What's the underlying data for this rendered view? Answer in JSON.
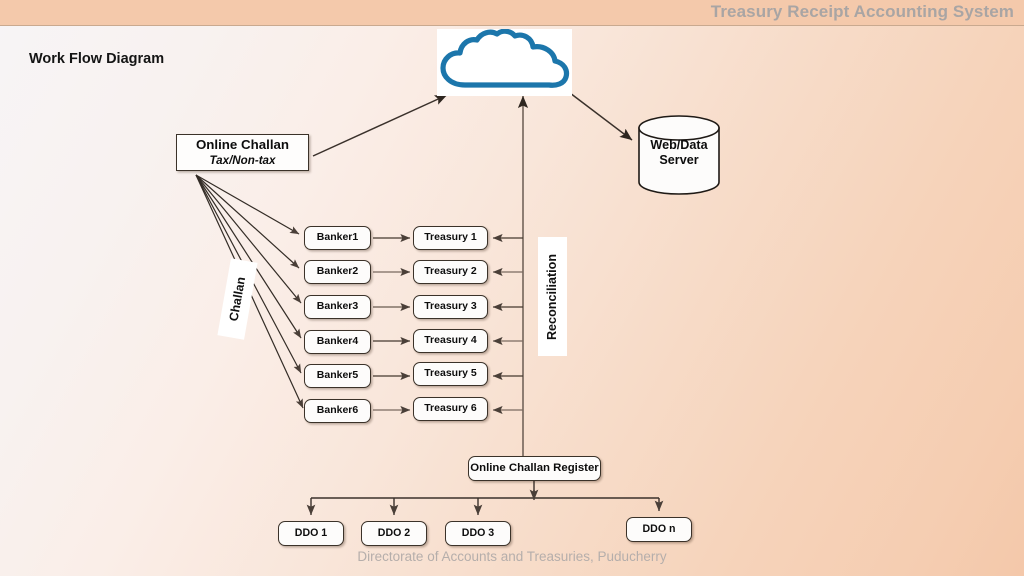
{
  "header": {
    "title": "Treasury Receipt Accounting System"
  },
  "page": {
    "title": "Work Flow Diagram",
    "footer": "Directorate of Accounts and Treasuries, Puducherry"
  },
  "diagram": {
    "cloud": {
      "icon": "cloud-icon",
      "label": ""
    },
    "online_challan": {
      "title": "Online Challan",
      "subtitle": "Tax/Non-tax"
    },
    "server": {
      "label_line1": "Web/Data",
      "label_line2": "Server"
    },
    "challan_flow_label": "Challan",
    "reconciliation_label": "Reconciliation",
    "bankers": [
      {
        "label": "Banker1"
      },
      {
        "label": "Banker2"
      },
      {
        "label": "Banker3"
      },
      {
        "label": "Banker4"
      },
      {
        "label": "Banker5"
      },
      {
        "label": "Banker6"
      }
    ],
    "treasuries": [
      {
        "label": "Treasury 1"
      },
      {
        "label": "Treasury 2"
      },
      {
        "label": "Treasury 3"
      },
      {
        "label": "Treasury 4"
      },
      {
        "label": "Treasury 5"
      },
      {
        "label": "Treasury 6"
      }
    ],
    "challan_register": {
      "label": "Online Challan Register"
    },
    "ddos": [
      {
        "label": "DDO 1"
      },
      {
        "label": "DDO 2"
      },
      {
        "label": "DDO 3"
      },
      {
        "label": "DDO n"
      }
    ]
  },
  "colors": {
    "header_band": "#f4c9ab",
    "header_text": "#a9a5a4",
    "footer_text": "#b5aeab",
    "cloud_outline": "#1c76ab",
    "node_border": "#3b3229",
    "connector": "#6b5c52",
    "background_left": "#f7f4f6",
    "background_right": "#f4c8aa"
  }
}
